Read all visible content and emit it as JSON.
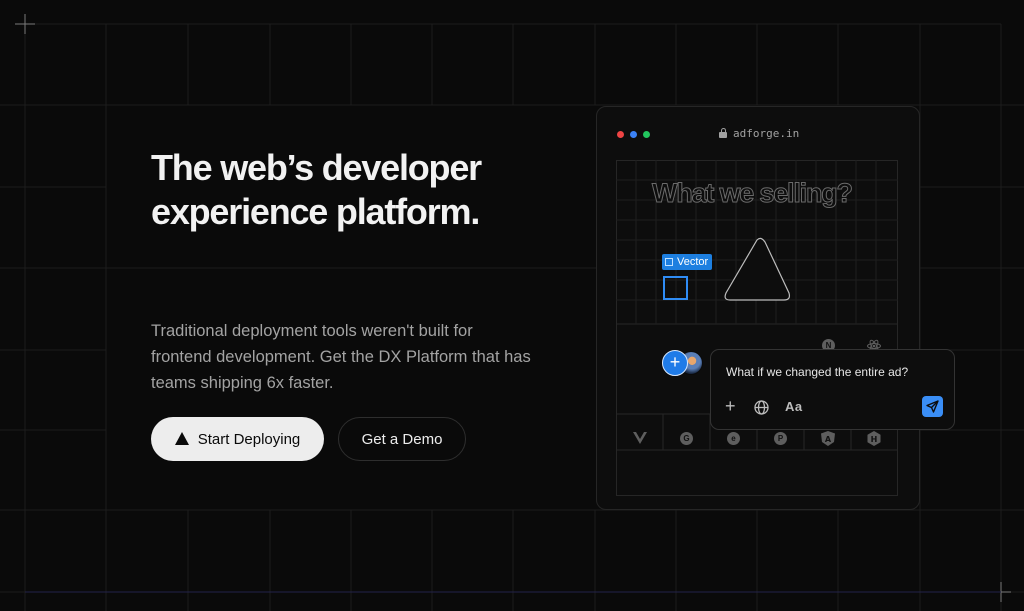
{
  "hero": {
    "title_lines": [
      "The web’s developer",
      "experience platform."
    ],
    "description_lines": [
      "Traditional deployment tools weren't built for",
      "frontend development. Get the DX Platform that has",
      "teams shipping 6x faster."
    ],
    "primary_button": "Start Deploying",
    "secondary_button": "Get a Demo"
  },
  "preview": {
    "window_dots": [
      "#ee4444",
      "#3b82f6",
      "#22c55e"
    ],
    "url": "adforge.in",
    "canvas_heading": "What we selling?",
    "layer_tag": "Vector",
    "chat": {
      "prompt": "What if we changed the entire ad?",
      "plus_label": "+",
      "text_style_label": "Aa"
    },
    "framework_icons": [
      "vue-icon",
      "gatsby-icon",
      "ember-icon",
      "python-icon",
      "angular-icon",
      "hugo-icon",
      "next-icon",
      "react-icon"
    ]
  },
  "colors": {
    "background": "#0a0a0a",
    "accent_blue": "#3a8ef6",
    "grid_line": "#1f1f1f"
  }
}
